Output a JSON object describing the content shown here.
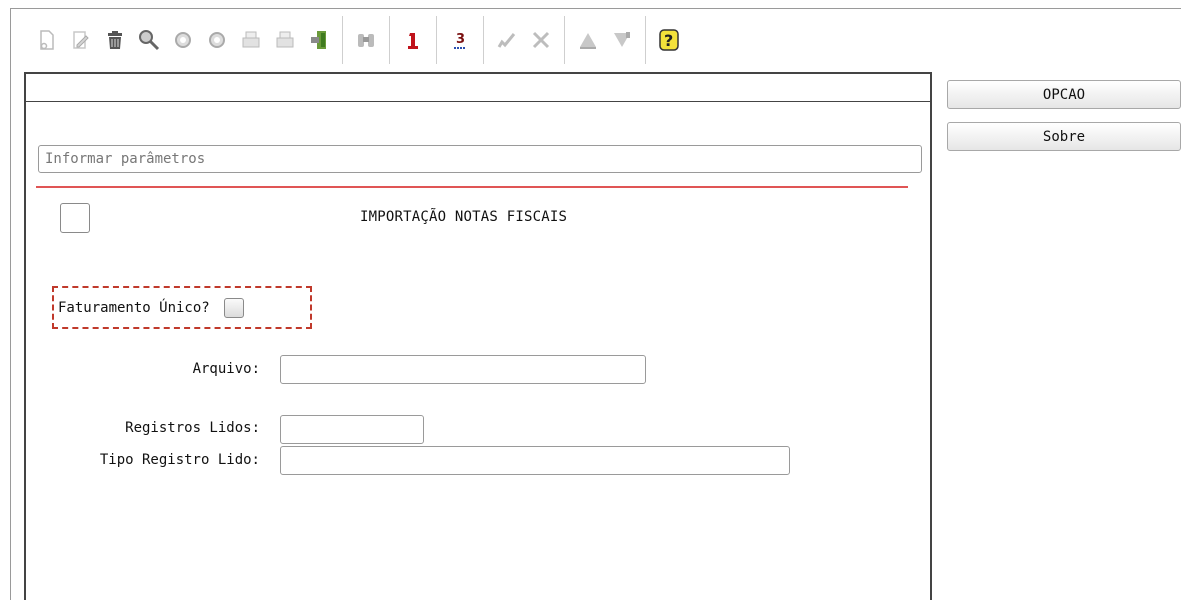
{
  "toolbar": {
    "icons": [
      "new-document-icon",
      "edit-icon",
      "trash-icon",
      "search-icon",
      "previous-icon",
      "next-icon",
      "print-icon",
      "print-preview-icon",
      "exit-icon",
      "binoculars-icon",
      "info-icon",
      "numbering-icon",
      "confirm-icon",
      "cancel-icon",
      "first-record-icon",
      "last-record-icon",
      "help-icon"
    ]
  },
  "form": {
    "parameters_placeholder": "Informar parâmetros",
    "heading": "IMPORTAÇÃO NOTAS FISCAIS",
    "faturamento_label": "Faturamento Único?",
    "arquivo_label": "Arquivo:",
    "registros_lidos_label": "Registros Lidos:",
    "tipo_registro_label": "Tipo Registro Lido:",
    "arquivo_value": "",
    "registros_lidos_value": "",
    "tipo_registro_value": ""
  },
  "side": {
    "opcao_label": "OPCAO",
    "sobre_label": "Sobre"
  },
  "colors": {
    "accent_red": "#e05555",
    "highlight_dash": "#c0392b"
  }
}
